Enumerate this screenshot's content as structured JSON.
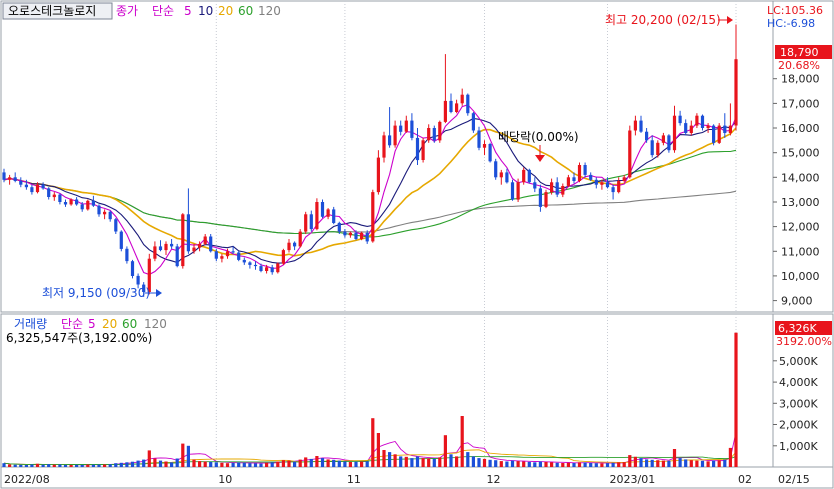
{
  "title": "오로스테크놀로지",
  "price_legend": {
    "prefix": "종가",
    "type": "단순",
    "periods": [
      "5",
      "10",
      "20",
      "60",
      "120"
    ]
  },
  "volume_legend": {
    "prefix": "거래량",
    "type": "단순",
    "periods": [
      "5",
      "20",
      "60",
      "120"
    ]
  },
  "ma_colors": {
    "5": "#cc00cc",
    "10": "#1a1a7a",
    "20": "#e6a800",
    "60": "#2ca02c",
    "120": "#808080"
  },
  "lc_label": "LC:105.36",
  "hc_label": "HC:-6.98",
  "current_price": "18,790",
  "current_change": "20.68%",
  "high_annotation": "최고 20,200 (02/15)",
  "low_annotation": "최저 9,150 (09/30)",
  "dividend_annotation": "배당락(0.00%)",
  "volume_info": "6,325,547주(3,192.00%)",
  "current_volume": "6,326K",
  "current_volume_pct": "3192.00%",
  "x_labels": [
    "2022/08",
    "10",
    "11",
    "12",
    "2023/01",
    "02",
    "02/15"
  ],
  "price_ticks": [
    "18,000",
    "17,000",
    "16,000",
    "15,000",
    "14,000",
    "13,000",
    "12,000",
    "11,000",
    "10,000",
    "9,000"
  ],
  "volume_ticks": [
    "5,000K",
    "4,000K",
    "3,000K",
    "2,000K",
    "1,000K"
  ],
  "colors": {
    "up": "#e8141c",
    "down": "#1c4fd8",
    "accent": "#e8141c"
  },
  "chart_data": {
    "type": "candlestick",
    "price_range": [
      8700,
      20300
    ],
    "volume_range": [
      0,
      6500
    ],
    "volume_unit": "K",
    "ohlcv": [
      [
        14200,
        14350,
        13800,
        13900,
        180
      ],
      [
        13900,
        14100,
        13700,
        14000,
        120
      ],
      [
        14000,
        14200,
        13800,
        13850,
        110
      ],
      [
        13850,
        14000,
        13600,
        13700,
        100
      ],
      [
        13700,
        13900,
        13500,
        13600,
        95
      ],
      [
        13600,
        13700,
        13300,
        13400,
        120
      ],
      [
        13400,
        13800,
        13350,
        13700,
        150
      ],
      [
        13700,
        13800,
        13500,
        13550,
        110
      ],
      [
        13550,
        13600,
        13100,
        13200,
        130
      ],
      [
        13200,
        13400,
        13050,
        13300,
        110
      ],
      [
        13300,
        13350,
        12900,
        13000,
        120
      ],
      [
        13000,
        13100,
        12800,
        12900,
        100
      ],
      [
        12900,
        13150,
        12850,
        13100,
        100
      ],
      [
        13100,
        13200,
        12850,
        12900,
        105
      ],
      [
        12900,
        13000,
        12600,
        12700,
        100
      ],
      [
        12700,
        13100,
        12650,
        13050,
        120
      ],
      [
        13050,
        13250,
        12800,
        12850,
        110
      ],
      [
        12850,
        12900,
        12400,
        12500,
        115
      ],
      [
        12500,
        12700,
        12300,
        12600,
        120
      ],
      [
        12600,
        12650,
        12200,
        12300,
        130
      ],
      [
        12300,
        12350,
        11700,
        11800,
        180
      ],
      [
        11800,
        11850,
        11000,
        11100,
        200
      ],
      [
        11100,
        11200,
        10500,
        10600,
        220
      ],
      [
        10600,
        10650,
        9900,
        10000,
        250
      ],
      [
        10000,
        10100,
        9500,
        9650,
        300
      ],
      [
        9650,
        9750,
        9150,
        9350,
        350
      ],
      [
        9350,
        10900,
        9250,
        10700,
        780
      ],
      [
        10700,
        11400,
        10600,
        11200,
        400
      ],
      [
        11200,
        11450,
        11000,
        11050,
        300
      ],
      [
        11050,
        11400,
        10850,
        11300,
        260
      ],
      [
        11300,
        11500,
        11100,
        11200,
        220
      ],
      [
        11200,
        11300,
        10350,
        10400,
        400
      ],
      [
        10400,
        12550,
        10300,
        12500,
        1100
      ],
      [
        12500,
        13550,
        10900,
        11000,
        1000
      ],
      [
        11000,
        11300,
        10900,
        11150,
        350
      ],
      [
        11150,
        11400,
        11000,
        11300,
        280
      ],
      [
        11300,
        11700,
        11250,
        11600,
        260
      ],
      [
        11600,
        11700,
        10950,
        11000,
        240
      ],
      [
        11000,
        11100,
        10600,
        10700,
        220
      ],
      [
        10700,
        10900,
        10550,
        10800,
        200
      ],
      [
        10800,
        11100,
        10700,
        11000,
        180
      ],
      [
        11000,
        11200,
        10900,
        10950,
        190
      ],
      [
        10950,
        11000,
        10600,
        10650,
        210
      ],
      [
        10650,
        10750,
        10450,
        10550,
        200
      ],
      [
        10550,
        10600,
        10300,
        10450,
        180
      ],
      [
        10450,
        10600,
        10250,
        10400,
        170
      ],
      [
        10400,
        10500,
        10150,
        10200,
        160
      ],
      [
        10200,
        10450,
        10100,
        10350,
        200
      ],
      [
        10350,
        10450,
        10050,
        10150,
        220
      ],
      [
        10150,
        10550,
        10100,
        10500,
        260
      ],
      [
        10500,
        11100,
        10450,
        11050,
        320
      ],
      [
        11050,
        11500,
        10950,
        11350,
        300
      ],
      [
        11350,
        11400,
        11050,
        11200,
        260
      ],
      [
        11200,
        11900,
        11150,
        11800,
        350
      ],
      [
        11800,
        12600,
        11700,
        12500,
        450
      ],
      [
        12500,
        12650,
        11800,
        11900,
        380
      ],
      [
        11900,
        13150,
        11850,
        13000,
        520
      ],
      [
        13000,
        13100,
        12350,
        12400,
        420
      ],
      [
        12400,
        12750,
        12300,
        12700,
        360
      ],
      [
        12700,
        12800,
        12100,
        12150,
        340
      ],
      [
        12150,
        12200,
        11700,
        11800,
        300
      ],
      [
        11800,
        11900,
        11550,
        11650,
        260
      ],
      [
        11650,
        11800,
        11550,
        11750,
        240
      ],
      [
        11750,
        11850,
        11450,
        11500,
        250
      ],
      [
        11500,
        11800,
        11450,
        11750,
        260
      ],
      [
        11750,
        11850,
        11300,
        11400,
        270
      ],
      [
        11400,
        13500,
        11350,
        13400,
        2300
      ],
      [
        13400,
        15100,
        13300,
        14800,
        1600
      ],
      [
        14800,
        15850,
        14600,
        15700,
        800
      ],
      [
        15700,
        16850,
        15200,
        15300,
        700
      ],
      [
        15300,
        16300,
        15200,
        16100,
        600
      ],
      [
        16100,
        16300,
        15700,
        15850,
        500
      ],
      [
        15850,
        16500,
        15800,
        16300,
        480
      ],
      [
        16300,
        16600,
        15500,
        15600,
        420
      ],
      [
        15600,
        16000,
        14500,
        14700,
        500
      ],
      [
        14700,
        15600,
        14600,
        15500,
        420
      ],
      [
        15500,
        16150,
        15400,
        16000,
        400
      ],
      [
        16000,
        16100,
        15400,
        15500,
        380
      ],
      [
        15500,
        16300,
        15400,
        16250,
        450
      ],
      [
        16250,
        19000,
        16200,
        17100,
        1500
      ],
      [
        17100,
        17400,
        16600,
        16650,
        600
      ],
      [
        16650,
        17150,
        16600,
        17000,
        500
      ],
      [
        17000,
        17600,
        16900,
        17350,
        2400
      ],
      [
        17350,
        17400,
        16500,
        16600,
        700
      ],
      [
        16600,
        16650,
        15800,
        15900,
        500
      ],
      [
        15900,
        16050,
        15100,
        15200,
        420
      ],
      [
        15200,
        15500,
        14900,
        15350,
        380
      ],
      [
        15350,
        15400,
        14600,
        14650,
        340
      ],
      [
        14650,
        14750,
        13900,
        14000,
        320
      ],
      [
        14000,
        14300,
        13700,
        14200,
        280
      ],
      [
        14200,
        14350,
        13750,
        13800,
        260
      ],
      [
        13800,
        13900,
        13050,
        13100,
        300
      ],
      [
        13100,
        13950,
        13000,
        13800,
        280
      ],
      [
        13800,
        14400,
        13700,
        14300,
        260
      ],
      [
        14300,
        14350,
        13750,
        13800,
        240
      ],
      [
        13800,
        14000,
        13400,
        13550,
        220
      ],
      [
        13550,
        13700,
        12600,
        12800,
        260
      ],
      [
        12800,
        13500,
        12750,
        13400,
        240
      ],
      [
        13400,
        13950,
        13300,
        13800,
        220
      ],
      [
        13800,
        14000,
        13200,
        13300,
        200
      ],
      [
        13300,
        13750,
        13200,
        13650,
        190
      ],
      [
        13650,
        14100,
        13600,
        14000,
        200
      ],
      [
        14000,
        14200,
        13750,
        13850,
        190
      ],
      [
        13850,
        14600,
        13800,
        14500,
        220
      ],
      [
        14500,
        14600,
        14000,
        14100,
        210
      ],
      [
        14100,
        14200,
        13850,
        13900,
        190
      ],
      [
        13900,
        14000,
        13550,
        13700,
        180
      ],
      [
        13700,
        13900,
        13500,
        13800,
        170
      ],
      [
        13800,
        14000,
        13550,
        13600,
        180
      ],
      [
        13600,
        13700,
        13100,
        13400,
        200
      ],
      [
        13400,
        14000,
        13350,
        13850,
        220
      ],
      [
        13850,
        14100,
        13800,
        14000,
        230
      ],
      [
        14000,
        16100,
        13950,
        15900,
        560
      ],
      [
        15900,
        16500,
        15700,
        16300,
        480
      ],
      [
        16300,
        16500,
        15800,
        15850,
        420
      ],
      [
        15850,
        16000,
        15400,
        15500,
        360
      ],
      [
        15500,
        15700,
        14800,
        14900,
        340
      ],
      [
        14900,
        15500,
        14800,
        15400,
        320
      ],
      [
        15400,
        15800,
        15300,
        15700,
        300
      ],
      [
        15700,
        15750,
        15000,
        15100,
        290
      ],
      [
        15100,
        16900,
        15000,
        16500,
        850
      ],
      [
        16500,
        16700,
        16100,
        16200,
        420
      ],
      [
        16200,
        16350,
        15700,
        15800,
        360
      ],
      [
        15800,
        16300,
        15700,
        16100,
        320
      ],
      [
        16100,
        16600,
        16000,
        16500,
        300
      ],
      [
        16500,
        16550,
        15900,
        16000,
        290
      ],
      [
        16000,
        16200,
        15800,
        16100,
        270
      ],
      [
        16100,
        16150,
        15300,
        15400,
        300
      ],
      [
        15400,
        16200,
        15350,
        16100,
        320
      ],
      [
        16100,
        16600,
        15600,
        15800,
        350
      ],
      [
        15800,
        17000,
        15700,
        16100,
        900
      ],
      [
        16100,
        20200,
        15900,
        18790,
        6326
      ]
    ]
  }
}
